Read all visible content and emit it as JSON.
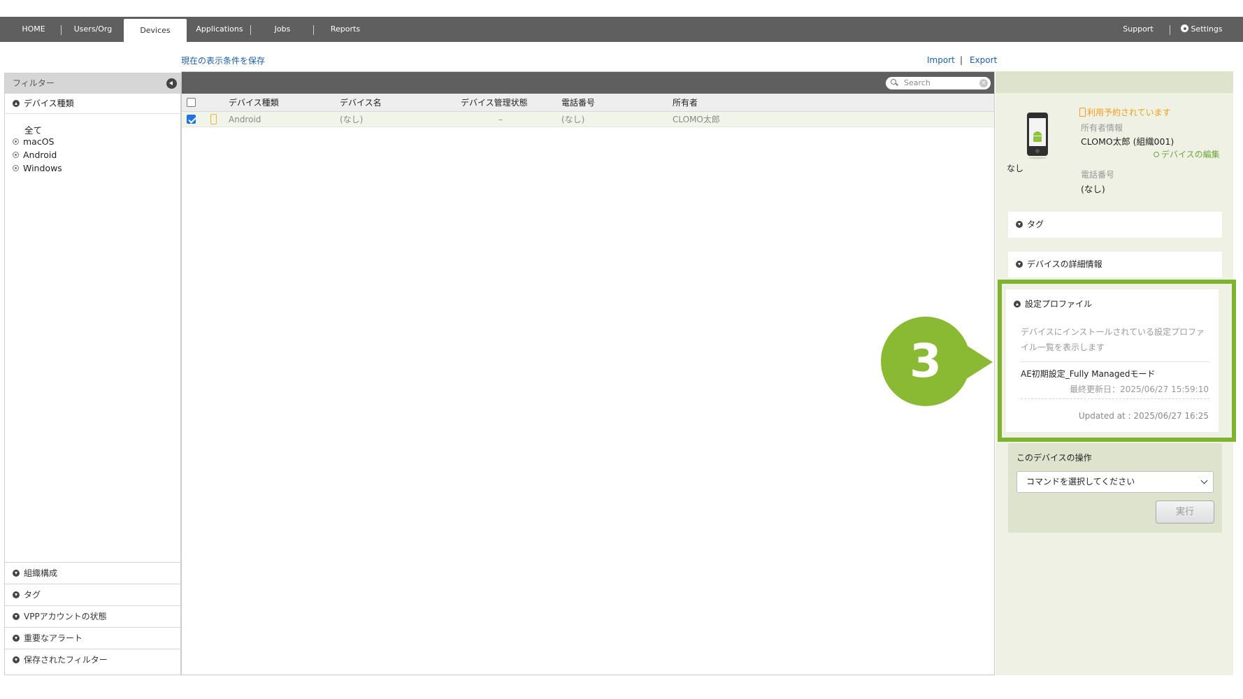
{
  "nav": {
    "items": [
      "HOME",
      "Users/Org",
      "Devices",
      "Applications",
      "Jobs",
      "Reports"
    ],
    "active": "Devices",
    "support": "Support",
    "settings": "Settings"
  },
  "actions": {
    "save_view": "現在の表示条件を保存",
    "import": "Import",
    "separator": "|",
    "export": "Export"
  },
  "filter": {
    "title": "フィルター",
    "device_type_section": "デバイス種類",
    "options": [
      "全て",
      "macOS",
      "Android",
      "Windows"
    ],
    "bottom_sections": [
      "組織構成",
      "タグ",
      "VPPアカウントの状態",
      "重要なアラート",
      "保存されたフィルター"
    ]
  },
  "table": {
    "search_placeholder": "Search",
    "columns": [
      "デバイス種類",
      "デバイス名",
      "デバイス管理状態",
      "電話番号",
      "所有者"
    ],
    "rows": [
      {
        "checked": true,
        "device_type": "Android",
        "device_name": "(なし)",
        "status": "–",
        "phone": "(なし)",
        "owner": "CLOMO太郎"
      }
    ]
  },
  "detail": {
    "reservation_notice": "利用予約されています",
    "owner_label": "所有者情報",
    "owner_value": "CLOMO太郎 (組織001)",
    "edit_link": "デバイスの編集",
    "device_caption": "なし",
    "phone_label": "電話番号",
    "phone_value": "(なし)",
    "tag_section": "タグ",
    "details_section": "デバイスの詳細情報",
    "profile_section": {
      "title": "設定プロファイル",
      "description": "デバイスにインストールされている設定プロファイル一覧を表示します",
      "profile_name": "AE初期設定_Fully Managedモード",
      "last_updated": "最終更新日：2025/06/27 15:59:10",
      "updated_at": "Updated at : 2025/06/27 16:25"
    },
    "operations": {
      "title": "このデバイスの操作",
      "select_value": "コマンドを選択してください",
      "run_button": "実行"
    }
  },
  "callout": {
    "number": "3",
    "color": "#8aba33"
  },
  "colors": {
    "nav": "#5f5f5f",
    "accent_green": "#7db32f",
    "warning": "#f29d1c",
    "link": "#1d5fa8"
  }
}
